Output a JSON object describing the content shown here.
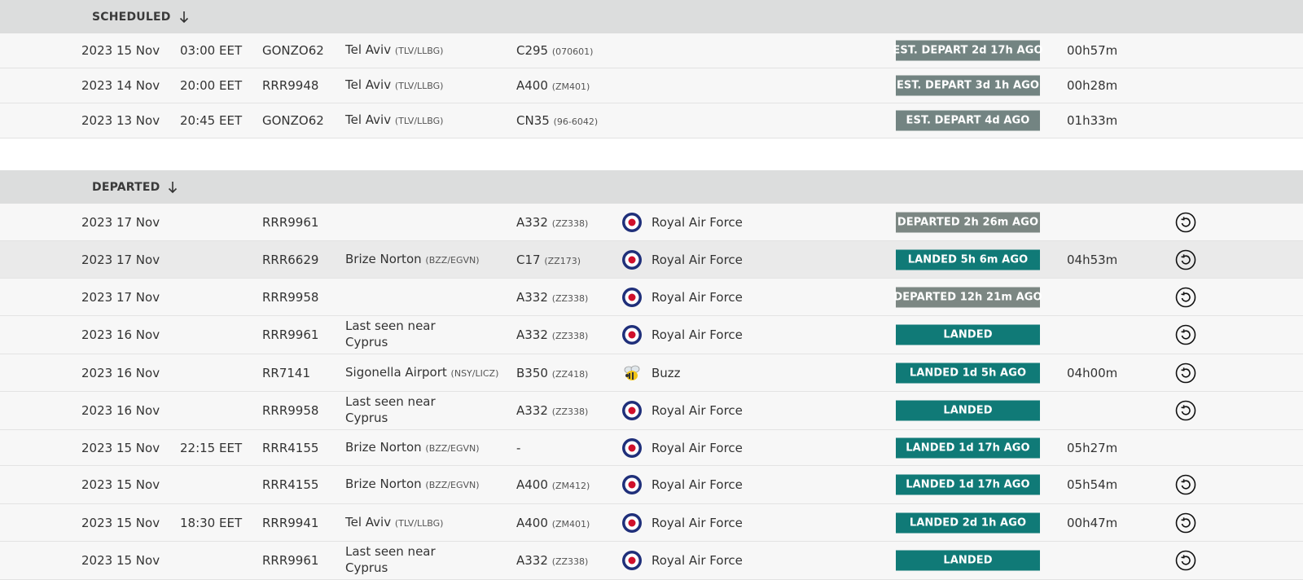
{
  "sections": {
    "scheduled": {
      "title": "SCHEDULED"
    },
    "departed": {
      "title": "DEPARTED"
    }
  },
  "scheduled_rows": [
    {
      "date": "2023 15 Nov",
      "time": "03:00 EET",
      "flight": "GONZO62",
      "dest": "Tel Aviv",
      "dest_code": "(TLV/LLBG)",
      "aircraft": "C295",
      "reg": "(070601)",
      "status": "EST. DEPART 2d 17h AGO",
      "duration": "00h57m"
    },
    {
      "date": "2023 14 Nov",
      "time": "20:00 EET",
      "flight": "RRR9948",
      "dest": "Tel Aviv",
      "dest_code": "(TLV/LLBG)",
      "aircraft": "A400",
      "reg": "(ZM401)",
      "status": "EST. DEPART 3d 1h AGO",
      "duration": "00h28m"
    },
    {
      "date": "2023 13 Nov",
      "time": "20:45 EET",
      "flight": "GONZO62",
      "dest": "Tel Aviv",
      "dest_code": "(TLV/LLBG)",
      "aircraft": "CN35",
      "reg": "(96-6042)",
      "status": "EST. DEPART 4d AGO",
      "duration": "01h33m"
    }
  ],
  "departed_rows": [
    {
      "date": "2023 17 Nov",
      "time": "",
      "flight": "RRR9961",
      "dest": "",
      "dest_code": "",
      "aircraft": "A332",
      "reg": "(ZZ338)",
      "operator": "Royal Air Force",
      "logo": "raf-roundel-icon",
      "status": "DEPARTED 2h 26m AGO",
      "status_type": "dep",
      "duration": "",
      "replay": true
    },
    {
      "date": "2023 17 Nov",
      "time": "",
      "flight": "RRR6629",
      "dest": "Brize Norton",
      "dest_code": "(BZZ/EGVN)",
      "aircraft": "C17",
      "reg": "(ZZ173)",
      "operator": "Royal Air Force",
      "logo": "raf-roundel-icon",
      "status": "LANDED 5h 6m AGO",
      "status_type": "land",
      "duration": "04h53m",
      "replay": true
    },
    {
      "date": "2023 17 Nov",
      "time": "",
      "flight": "RRR9958",
      "dest": "",
      "dest_code": "",
      "aircraft": "A332",
      "reg": "(ZZ338)",
      "operator": "Royal Air Force",
      "logo": "raf-roundel-icon",
      "status": "DEPARTED 12h 21m AGO",
      "status_type": "dep",
      "duration": "",
      "replay": true
    },
    {
      "date": "2023 16 Nov",
      "time": "",
      "flight": "RRR9961",
      "dest": "Last seen near Cyprus",
      "dest_code": "",
      "aircraft": "A332",
      "reg": "(ZZ338)",
      "operator": "Royal Air Force",
      "logo": "raf-roundel-icon",
      "status": "LANDED",
      "status_type": "land",
      "duration": "",
      "replay": true
    },
    {
      "date": "2023 16 Nov",
      "time": "",
      "flight": "RR7141",
      "dest": "Sigonella Airport",
      "dest_code": "(NSY/LICZ)",
      "aircraft": "B350",
      "reg": "(ZZ418)",
      "operator": "Buzz",
      "logo": "bee-icon",
      "status": "LANDED 1d 5h AGO",
      "status_type": "land",
      "duration": "04h00m",
      "replay": true
    },
    {
      "date": "2023 16 Nov",
      "time": "",
      "flight": "RRR9958",
      "dest": "Last seen near Cyprus",
      "dest_code": "",
      "aircraft": "A332",
      "reg": "(ZZ338)",
      "operator": "Royal Air Force",
      "logo": "raf-roundel-icon",
      "status": "LANDED",
      "status_type": "land",
      "duration": "",
      "replay": true
    },
    {
      "date": "2023 15 Nov",
      "time": "22:15 EET",
      "flight": "RRR4155",
      "dest": "Brize Norton",
      "dest_code": "(BZZ/EGVN)",
      "aircraft": "-",
      "reg": "",
      "operator": "Royal Air Force",
      "logo": "raf-roundel-icon",
      "status": "LANDED 1d 17h AGO",
      "status_type": "land",
      "duration": "05h27m",
      "replay": false
    },
    {
      "date": "2023 15 Nov",
      "time": "",
      "flight": "RRR4155",
      "dest": "Brize Norton",
      "dest_code": "(BZZ/EGVN)",
      "aircraft": "A400",
      "reg": "(ZM412)",
      "operator": "Royal Air Force",
      "logo": "raf-roundel-icon",
      "status": "LANDED 1d 17h AGO",
      "status_type": "land",
      "duration": "05h54m",
      "replay": true
    },
    {
      "date": "2023 15 Nov",
      "time": "18:30 EET",
      "flight": "RRR9941",
      "dest": "Tel Aviv",
      "dest_code": "(TLV/LLBG)",
      "aircraft": "A400",
      "reg": "(ZM401)",
      "operator": "Royal Air Force",
      "logo": "raf-roundel-icon",
      "status": "LANDED 2d 1h AGO",
      "status_type": "land",
      "duration": "00h47m",
      "replay": true
    },
    {
      "date": "2023 15 Nov",
      "time": "",
      "flight": "RRR9961",
      "dest": "Last seen near Cyprus",
      "dest_code": "",
      "aircraft": "A332",
      "reg": "(ZZ338)",
      "operator": "Royal Air Force",
      "logo": "raf-roundel-icon",
      "status": "LANDED",
      "status_type": "land",
      "duration": "",
      "replay": true
    }
  ]
}
